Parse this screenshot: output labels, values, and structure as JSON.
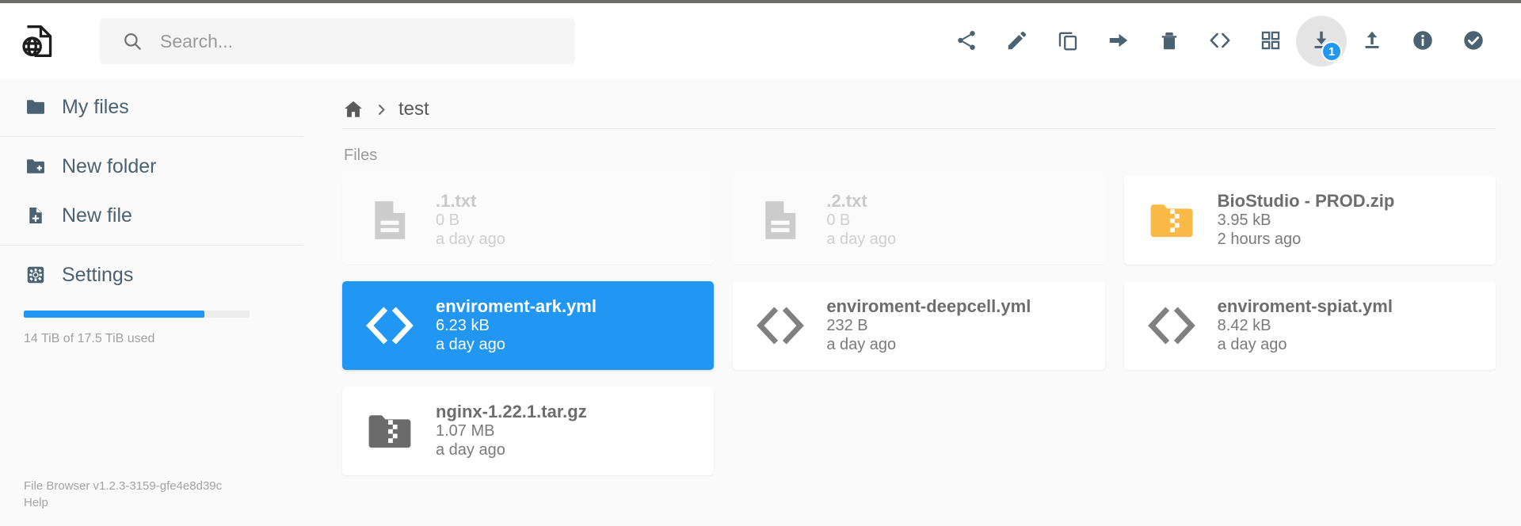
{
  "app": {
    "logo_icon": "file-globe-logo-icon",
    "accent_color": "#2196f3",
    "toolbar_icon_color": "#4b6272"
  },
  "search": {
    "placeholder": "Search...",
    "value": "",
    "icon": "search-icon"
  },
  "toolbar": {
    "buttons": [
      {
        "name": "share",
        "label": "Share",
        "icon": "share-icon",
        "badge": null,
        "hovered": false
      },
      {
        "name": "rename",
        "label": "Rename",
        "icon": "pencil-icon",
        "badge": null,
        "hovered": false
      },
      {
        "name": "copy",
        "label": "Copy",
        "icon": "copy-icon",
        "badge": null,
        "hovered": false
      },
      {
        "name": "move",
        "label": "Move",
        "icon": "arrow-right-icon",
        "badge": null,
        "hovered": false
      },
      {
        "name": "delete",
        "label": "Delete",
        "icon": "trash-icon",
        "badge": null,
        "hovered": false
      },
      {
        "name": "view-code",
        "label": "Code",
        "icon": "code-brackets-icon",
        "badge": null,
        "hovered": false
      },
      {
        "name": "switch-view",
        "label": "Switch view",
        "icon": "grid-view-icon",
        "badge": null,
        "hovered": false
      },
      {
        "name": "download",
        "label": "Download",
        "icon": "download-icon",
        "badge": "1",
        "hovered": true
      },
      {
        "name": "upload",
        "label": "Upload",
        "icon": "upload-icon",
        "badge": null,
        "hovered": false
      },
      {
        "name": "info",
        "label": "Info",
        "icon": "info-circle-icon",
        "badge": null,
        "hovered": false
      },
      {
        "name": "select-multiple",
        "label": "Select multiple",
        "icon": "check-circle-icon",
        "badge": null,
        "hovered": false
      }
    ]
  },
  "sidebar": {
    "groups": [
      {
        "items": [
          {
            "label": "My files",
            "icon": "folder-icon"
          }
        ]
      },
      {
        "items": [
          {
            "label": "New folder",
            "icon": "folder-plus-icon"
          },
          {
            "label": "New file",
            "icon": "file-plus-icon"
          }
        ]
      },
      {
        "items": [
          {
            "label": "Settings",
            "icon": "gear-icon"
          }
        ]
      }
    ],
    "storage": {
      "used_percent": 80,
      "text": "14 TiB of 17.5 TiB used"
    },
    "footer": {
      "version": "File Browser v1.2.3-3159-gfe4e8d39c",
      "help": "Help"
    }
  },
  "breadcrumb": {
    "home_icon": "home-icon",
    "separator": "chevron-right-icon",
    "items": [
      "test"
    ]
  },
  "main": {
    "section_label": "Files",
    "files": [
      {
        "name": ".1.txt",
        "size": "0 B",
        "modified": "a day ago",
        "icon": "text-file-icon",
        "state": "hidden"
      },
      {
        "name": ".2.txt",
        "size": "0 B",
        "modified": "a day ago",
        "icon": "text-file-icon",
        "state": "hidden"
      },
      {
        "name": "BioStudio - PROD.zip",
        "size": "3.95 kB",
        "modified": "2 hours ago",
        "icon": "archive-folder-icon",
        "state": "normal",
        "icon_color": "#fbb945"
      },
      {
        "name": "enviroment-ark.yml",
        "size": "6.23 kB",
        "modified": "a day ago",
        "icon": "code-file-icon",
        "state": "selected"
      },
      {
        "name": "enviroment-deepcell.yml",
        "size": "232 B",
        "modified": "a day ago",
        "icon": "code-file-icon",
        "state": "normal"
      },
      {
        "name": "enviroment-spiat.yml",
        "size": "8.42 kB",
        "modified": "a day ago",
        "icon": "code-file-icon",
        "state": "normal"
      },
      {
        "name": "nginx-1.22.1.tar.gz",
        "size": "1.07 MB",
        "modified": "a day ago",
        "icon": "archive-folder-icon",
        "state": "normal",
        "icon_color": "#6b6b6b"
      }
    ]
  }
}
